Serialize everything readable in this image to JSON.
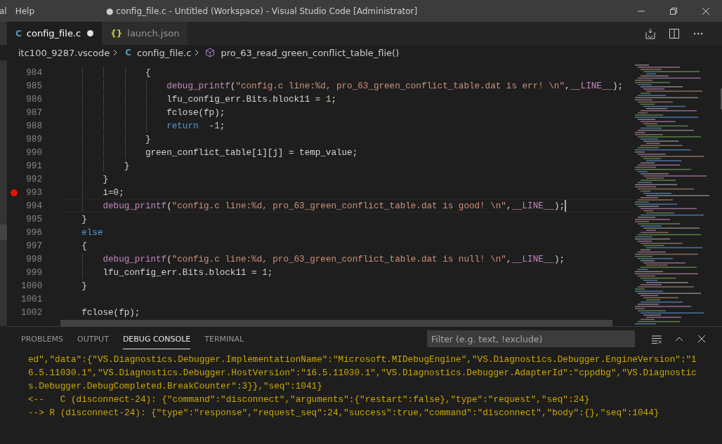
{
  "menu": [
    {
      "label": "al"
    },
    {
      "label": "Help"
    }
  ],
  "window": {
    "title": "● config_file.c - Untitled (Workspace) - Visual Studio Code [Administrator]"
  },
  "tabs": [
    {
      "label": "config_file.c",
      "icon": "C",
      "kind": "c",
      "selected": true,
      "modified": true
    },
    {
      "label": "launch.json",
      "icon": "{}",
      "kind": "json",
      "selected": false,
      "modified": false
    }
  ],
  "breadcrumbs": [
    {
      "kind": "folder",
      "label": "itc100_9287.vscode"
    },
    {
      "kind": "file",
      "icon": "C",
      "label": "config_file.c"
    },
    {
      "kind": "function",
      "label": "pro_63_read_green_conflict_table_flie()"
    }
  ],
  "code": [
    {
      "number": "984",
      "breakpoint": false,
      "current": false,
      "tokens": [
        {
          "kind": "plain",
          "text": "                {"
        }
      ]
    },
    {
      "number": "985",
      "breakpoint": false,
      "current": false,
      "tokens": [
        {
          "kind": "macro",
          "text": "                    debug_printf"
        },
        {
          "kind": "plain",
          "text": "("
        },
        {
          "kind": "string",
          "text": "\"config.c line:%d, pro_63_green_conflict_table.dat is err! \\n\""
        },
        {
          "kind": "plain",
          "text": ","
        },
        {
          "kind": "macro",
          "text": "__LINE__"
        },
        {
          "kind": "plain",
          "text": ");"
        }
      ]
    },
    {
      "number": "986",
      "breakpoint": false,
      "current": false,
      "tokens": [
        {
          "kind": "plain",
          "text": "                    lfu_config_err.Bits.block11 = "
        },
        {
          "kind": "number",
          "text": "1"
        },
        {
          "kind": "plain",
          "text": ";"
        }
      ]
    },
    {
      "number": "987",
      "breakpoint": false,
      "current": false,
      "tokens": [
        {
          "kind": "plain",
          "text": "                    fclose(fp);"
        }
      ]
    },
    {
      "number": "988",
      "breakpoint": false,
      "current": false,
      "tokens": [
        {
          "kind": "keyword",
          "text": "                    return"
        },
        {
          "kind": "plain",
          "text": "  -"
        },
        {
          "kind": "number",
          "text": "1"
        },
        {
          "kind": "plain",
          "text": ";"
        }
      ]
    },
    {
      "number": "989",
      "breakpoint": false,
      "current": false,
      "tokens": [
        {
          "kind": "plain",
          "text": "                }"
        }
      ]
    },
    {
      "number": "990",
      "breakpoint": false,
      "current": false,
      "tokens": [
        {
          "kind": "plain",
          "text": "                green_conflict_table[i][j] = temp_value;"
        }
      ]
    },
    {
      "number": "991",
      "breakpoint": false,
      "current": false,
      "tokens": [
        {
          "kind": "plain",
          "text": "            }"
        }
      ]
    },
    {
      "number": "992",
      "breakpoint": false,
      "current": false,
      "tokens": [
        {
          "kind": "plain",
          "text": "        }"
        }
      ]
    },
    {
      "number": "993",
      "breakpoint": true,
      "current": false,
      "tokens": [
        {
          "kind": "plain",
          "text": "        i=0;"
        }
      ]
    },
    {
      "number": "994",
      "breakpoint": false,
      "current": true,
      "tokens": [
        {
          "kind": "macro",
          "text": "        debug_printf"
        },
        {
          "kind": "plain",
          "text": "("
        },
        {
          "kind": "string",
          "text": "\"config.c line:%d, pro_63_green_conflict_table.dat is good! \\n\""
        },
        {
          "kind": "plain",
          "text": ","
        },
        {
          "kind": "macro",
          "text": "__LINE__"
        },
        {
          "kind": "plain",
          "text": ");"
        }
      ]
    },
    {
      "number": "995",
      "breakpoint": false,
      "current": false,
      "tokens": [
        {
          "kind": "plain",
          "text": "    }"
        }
      ]
    },
    {
      "number": "996",
      "breakpoint": false,
      "current": false,
      "tokens": [
        {
          "kind": "keyword",
          "text": "    else"
        }
      ]
    },
    {
      "number": "997",
      "breakpoint": false,
      "current": false,
      "tokens": [
        {
          "kind": "plain",
          "text": "    {"
        }
      ]
    },
    {
      "number": "998",
      "breakpoint": false,
      "current": false,
      "tokens": [
        {
          "kind": "macro",
          "text": "        debug_printf"
        },
        {
          "kind": "plain",
          "text": "("
        },
        {
          "kind": "string",
          "text": "\"config.c line:%d, pro_63_green_conflict_table.dat is null! \\n\""
        },
        {
          "kind": "plain",
          "text": ","
        },
        {
          "kind": "macro",
          "text": "__LINE__"
        },
        {
          "kind": "plain",
          "text": ");"
        }
      ]
    },
    {
      "number": "999",
      "breakpoint": false,
      "current": false,
      "tokens": [
        {
          "kind": "plain",
          "text": "        lfu_config_err.Bits.block11 = "
        },
        {
          "kind": "number",
          "text": "1"
        },
        {
          "kind": "plain",
          "text": ";"
        }
      ]
    },
    {
      "number": "1000",
      "breakpoint": false,
      "current": false,
      "tokens": [
        {
          "kind": "plain",
          "text": "    }"
        }
      ]
    },
    {
      "number": "1001",
      "breakpoint": false,
      "current": false
    },
    {
      "number": "1002",
      "breakpoint": false,
      "current": false,
      "tokens": [
        {
          "kind": "plain",
          "text": "    fclose(fp);"
        }
      ]
    }
  ],
  "panel": {
    "tabs": [
      {
        "label": "PROBLEMS",
        "selected": false
      },
      {
        "label": "OUTPUT",
        "selected": false
      },
      {
        "label": "DEBUG CONSOLE",
        "selected": true
      },
      {
        "label": "TERMINAL",
        "selected": false
      }
    ],
    "filter": {
      "placeholder": "Filter (e.g. text, !exclude)"
    },
    "console": [
      "ed\",\"data\":{\"VS.Diagnostics.Debugger.ImplementationName\":\"Microsoft.MIDebugEngine\",\"VS.Diagnostics.Debugger.EngineVersion\":\"1",
      "6.5.11030.1\",\"VS.Diagnostics.Debugger.HostVersion\":\"16.5.11030.1\",\"VS.Diagnostics.Debugger.AdapterId\":\"cppdbg\",\"VS.Diagnostic",
      "s.Debugger.DebugCompleted.BreakCounter\":3}},\"seq\":1041}",
      "<--   C (disconnect-24): {\"command\":\"disconnect\",\"arguments\":{\"restart\":false},\"type\":\"request\",\"seq\":24}",
      "--> R (disconnect-24): {\"type\":\"response\",\"request_seq\":24,\"success\":true,\"command\":\"disconnect\",\"body\":{},\"seq\":1044}"
    ]
  }
}
